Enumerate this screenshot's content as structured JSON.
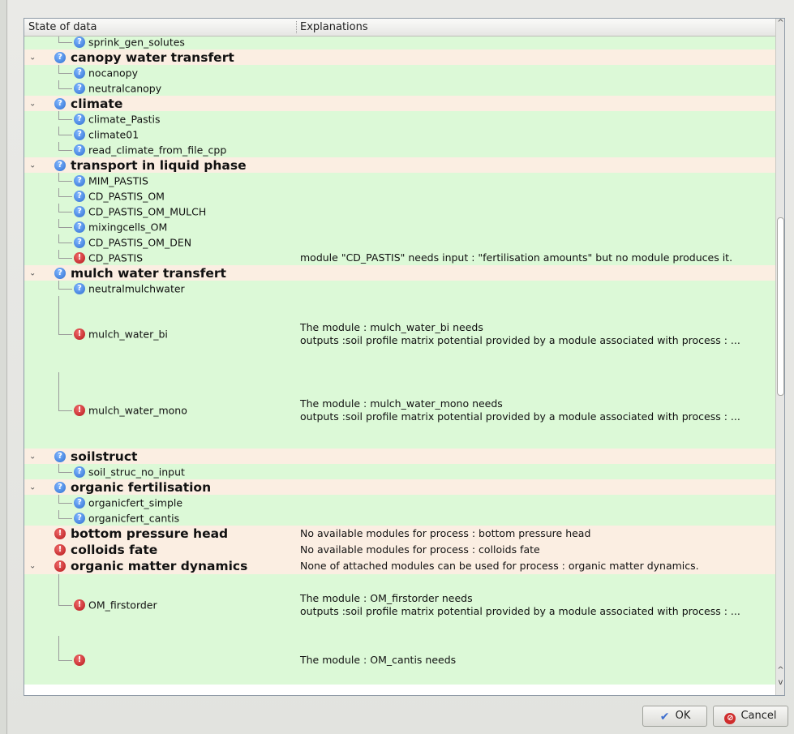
{
  "header": {
    "col_state": "State of data",
    "col_explanations": "Explanations"
  },
  "rows": [
    {
      "kind": "mod",
      "label": "sprink_gen_solutes",
      "status": "question",
      "explanation": ""
    },
    {
      "kind": "proc",
      "label": "canopy water transfert",
      "status": "question",
      "expanded": true,
      "explanation": ""
    },
    {
      "kind": "mod",
      "label": "nocanopy",
      "status": "question",
      "explanation": ""
    },
    {
      "kind": "mod",
      "label": "neutralcanopy",
      "status": "question",
      "explanation": ""
    },
    {
      "kind": "proc",
      "label": "climate",
      "status": "question",
      "expanded": true,
      "explanation": ""
    },
    {
      "kind": "mod",
      "label": "climate_Pastis",
      "status": "question",
      "explanation": ""
    },
    {
      "kind": "mod",
      "label": "climate01",
      "status": "question",
      "explanation": ""
    },
    {
      "kind": "mod",
      "label": "read_climate_from_file_cpp",
      "status": "question",
      "explanation": ""
    },
    {
      "kind": "proc",
      "label": "transport in liquid phase",
      "status": "question",
      "expanded": true,
      "explanation": ""
    },
    {
      "kind": "mod",
      "label": "MIM_PASTIS",
      "status": "question",
      "explanation": ""
    },
    {
      "kind": "mod",
      "label": "CD_PASTIS_OM",
      "status": "question",
      "explanation": ""
    },
    {
      "kind": "mod",
      "label": "CD_PASTIS_OM_MULCH",
      "status": "question",
      "explanation": ""
    },
    {
      "kind": "mod",
      "label": "mixingcells_OM",
      "status": "question",
      "explanation": ""
    },
    {
      "kind": "mod",
      "label": "CD_PASTIS_OM_DEN",
      "status": "question",
      "explanation": ""
    },
    {
      "kind": "mod",
      "label": "CD_PASTIS",
      "status": "error",
      "explanation": "module \"CD_PASTIS\" needs input : \"fertilisation amounts\" but no module produces it."
    },
    {
      "kind": "proc",
      "label": "mulch water transfert",
      "status": "question",
      "expanded": true,
      "explanation": ""
    },
    {
      "kind": "mod",
      "label": "neutralmulchwater",
      "status": "question",
      "explanation": ""
    },
    {
      "kind": "mod",
      "label": "mulch_water_bi",
      "status": "error",
      "explanation": "The module : mulch_water_bi needs",
      "explanation2": "outputs :soil profile matrix potential provided by a module associated with process : ..."
    },
    {
      "kind": "mod",
      "label": "mulch_water_mono",
      "status": "error",
      "explanation": "The module : mulch_water_mono needs",
      "explanation2": "outputs :soil profile matrix potential provided by a module associated with process : ..."
    },
    {
      "kind": "proc",
      "label": "soilstruct",
      "status": "question",
      "expanded": true,
      "explanation": ""
    },
    {
      "kind": "mod",
      "label": "soil_struc_no_input",
      "status": "question",
      "explanation": ""
    },
    {
      "kind": "proc",
      "label": "organic fertilisation",
      "status": "question",
      "expanded": true,
      "explanation": ""
    },
    {
      "kind": "mod",
      "label": "organicfert_simple",
      "status": "question",
      "explanation": ""
    },
    {
      "kind": "mod",
      "label": "organicfert_cantis",
      "status": "question",
      "explanation": ""
    },
    {
      "kind": "proc",
      "label": "bottom pressure head",
      "status": "error",
      "expanded": false,
      "explanation": "No available modules for process : bottom pressure head"
    },
    {
      "kind": "proc",
      "label": "colloids fate",
      "status": "error",
      "expanded": false,
      "explanation": "No available modules for process : colloids fate"
    },
    {
      "kind": "proc",
      "label": "organic matter dynamics",
      "status": "error",
      "expanded": true,
      "explanation": "None of attached modules can be used for process : organic matter dynamics."
    },
    {
      "kind": "mod",
      "label": "OM_firstorder",
      "status": "error",
      "explanation": "The module : OM_firstorder needs",
      "explanation2": "outputs :soil profile matrix potential provided by a module associated with process : ..."
    },
    {
      "kind": "mod",
      "label": "",
      "status": "error",
      "explanation": "The module : OM_cantis needs",
      "explanation2": ""
    }
  ],
  "buttons": {
    "ok": "OK",
    "cancel": "Cancel"
  },
  "icons": {
    "question": "help-question-icon",
    "error": "error-exclamation-icon",
    "ok": "checkmark-icon",
    "cancel": "cancel-icon"
  },
  "colors": {
    "process_row": "#fbeee2",
    "module_row": "#dcf9d7",
    "question_icon": "#2f6fd0",
    "error_icon": "#b5161a"
  }
}
